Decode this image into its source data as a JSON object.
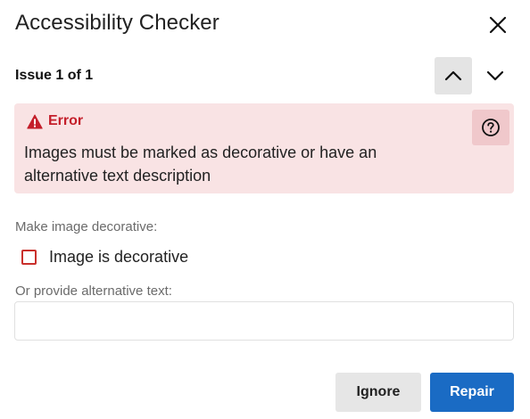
{
  "dialog": {
    "title": "Accessibility Checker",
    "close_icon": "close-icon"
  },
  "issue_nav": {
    "label": "Issue 1 of 1",
    "prev_icon": "chevron-up-icon",
    "next_icon": "chevron-down-icon"
  },
  "error": {
    "icon": "warning-triangle-icon",
    "title": "Error",
    "message": "Images must be marked as decorative or have an alternative text description",
    "help_icon": "help-circle-icon",
    "color": "#c41e2a",
    "background": "#f9e3e4"
  },
  "decorative": {
    "section_label": "Make image decorative:",
    "checkbox_label": "Image is decorative",
    "checked": false
  },
  "alt_text": {
    "section_label": "Or provide alternative text:",
    "value": "",
    "placeholder": ""
  },
  "actions": {
    "ignore_label": "Ignore",
    "repair_label": "Repair",
    "accent": "#1a6bc4"
  }
}
